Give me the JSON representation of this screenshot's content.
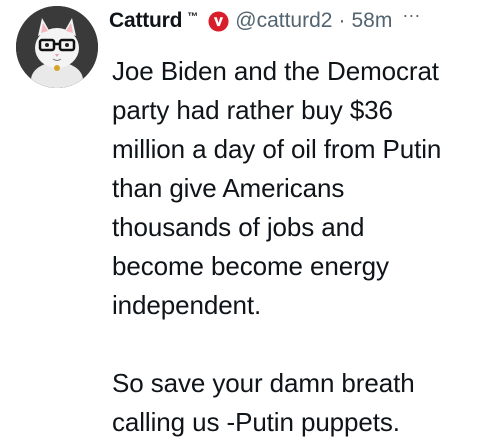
{
  "tweet": {
    "author": {
      "display_name": "Catturd",
      "trademark": "™",
      "handle": "@catturd2",
      "badge_icon": "v-badge-icon",
      "badge_color": "#d81e2a"
    },
    "separator": "·",
    "time": "58m",
    "more_label": "···",
    "text": {
      "paragraph_1_lines": [
        "Joe Biden and the Democrat",
        "party had rather buy $36",
        "million a day of oil from Putin",
        "than give Americans",
        "thousands of jobs and",
        "become become energy",
        "independent."
      ],
      "paragraph_2_lines": [
        "So save your damn breath",
        "calling us -Putin puppets."
      ]
    }
  }
}
